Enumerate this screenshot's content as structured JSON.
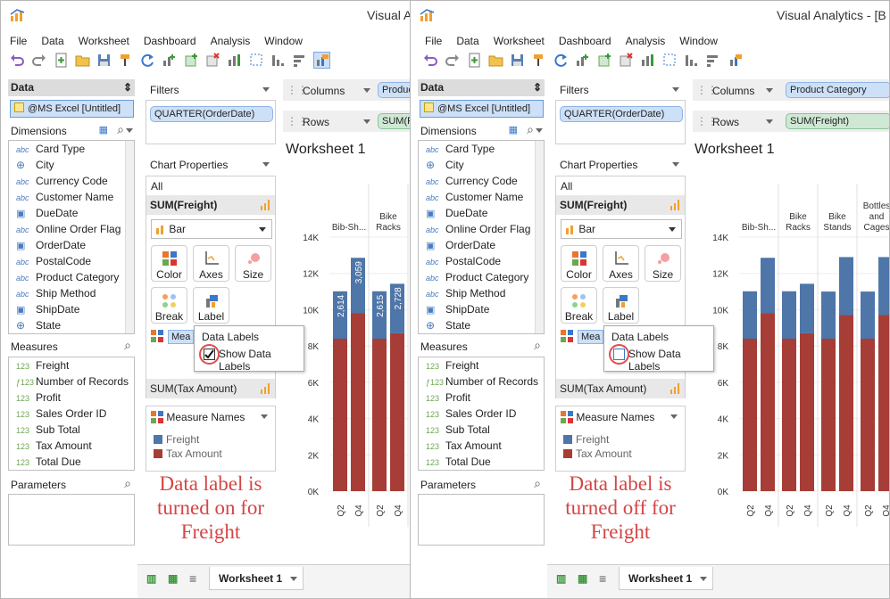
{
  "window": {
    "title": "Visual Analytics - [B"
  },
  "menu": [
    "File",
    "Data",
    "Worksheet",
    "Dashboard",
    "Analysis",
    "Window"
  ],
  "data_pane": {
    "header": "Data",
    "datasource": "@MS Excel [Untitled]",
    "dimensions_label": "Dimensions",
    "dimensions": [
      {
        "icon": "abc",
        "label": "Card Type"
      },
      {
        "icon": "globe",
        "label": "City"
      },
      {
        "icon": "abc",
        "label": "Currency Code"
      },
      {
        "icon": "abc",
        "label": "Customer Name"
      },
      {
        "icon": "date",
        "label": "DueDate"
      },
      {
        "icon": "abc",
        "label": "Online Order Flag"
      },
      {
        "icon": "date",
        "label": "OrderDate"
      },
      {
        "icon": "abc",
        "label": "PostalCode"
      },
      {
        "icon": "abc",
        "label": "Product Category"
      },
      {
        "icon": "abc",
        "label": "Ship Method"
      },
      {
        "icon": "date",
        "label": "ShipDate"
      },
      {
        "icon": "globe",
        "label": "State"
      }
    ],
    "measures_label": "Measures",
    "measures": [
      {
        "icon": "123",
        "label": "Freight"
      },
      {
        "icon": "f123",
        "label": "Number of Records"
      },
      {
        "icon": "123",
        "label": "Profit"
      },
      {
        "icon": "123",
        "label": "Sales Order ID"
      },
      {
        "icon": "123",
        "label": "Sub Total"
      },
      {
        "icon": "123",
        "label": "Tax Amount"
      },
      {
        "icon": "123",
        "label": "Total Due"
      }
    ],
    "parameters_label": "Parameters"
  },
  "filters": {
    "label": "Filters",
    "items": [
      "QUARTER(OrderDate)"
    ]
  },
  "chart_properties": {
    "label": "Chart Properties",
    "all": "All",
    "freight_label": "SUM(Freight)",
    "mark_type": "Bar",
    "buttons": [
      "Color",
      "Axes",
      "Size",
      "Break",
      "Label"
    ],
    "measure_chip": "Mea",
    "tax_label": "SUM(Tax Amount)"
  },
  "measure_names_card": {
    "label": "Measure Names",
    "items": [
      "Freight",
      "Tax Amount"
    ]
  },
  "shelves": {
    "columns_label": "Columns",
    "rows_label": "Rows",
    "columns_pill": "Product Category",
    "rows_pill": "SUM(Freight)"
  },
  "popup": {
    "title": "Data Labels",
    "checkbox_label": "Show Data Labels"
  },
  "worksheet": {
    "title": "Worksheet 1",
    "tab": "Worksheet 1"
  },
  "captions": {
    "left": "Data label is turned on for Freight",
    "right": "Data label is turned off for Freight"
  },
  "colors": {
    "freight": "#4e76a8",
    "tax": "#a63d36",
    "accent": "#3a78c8"
  },
  "chart_data": {
    "type": "bar",
    "stacked": true,
    "categories": [
      "Bib-Sh...",
      "Bike Racks",
      "Bike Stands",
      "Bottles and Cages"
    ],
    "x_labels": [
      "Q2",
      "Q4"
    ],
    "ylim": [
      0,
      14000
    ],
    "yticks": [
      0,
      2000,
      4000,
      6000,
      8000,
      10000,
      12000,
      14000
    ],
    "ytick_labels": [
      "0K",
      "2K",
      "4K",
      "6K",
      "8K",
      "10K",
      "12K",
      "14K"
    ],
    "series": [
      {
        "name": "Tax Amount",
        "values": [
          8400,
          9800,
          8400,
          8700,
          8400,
          9700,
          8400,
          9700
        ]
      },
      {
        "name": "Freight",
        "values": [
          2614,
          3059,
          2615,
          2728,
          2600,
          3200,
          2600,
          3200
        ]
      }
    ],
    "data_labels_left": [
      "2,614",
      "3,059",
      "2,615",
      "2,728"
    ]
  }
}
